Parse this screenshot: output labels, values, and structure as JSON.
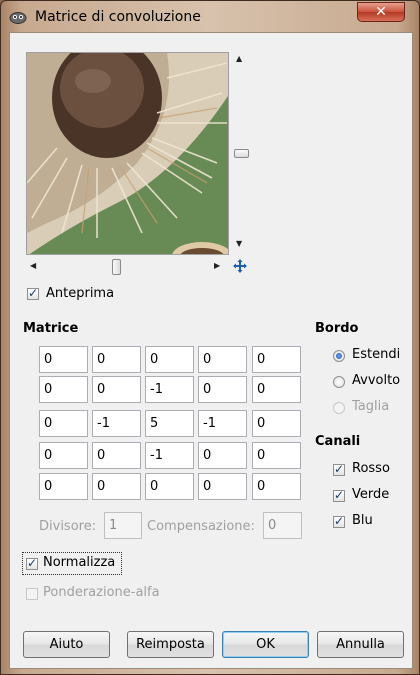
{
  "window": {
    "title": "Matrice di convoluzione",
    "close_label": "✕"
  },
  "preview": {
    "checkbox_label": "Anteprima",
    "checked": true
  },
  "matrix": {
    "title": "Matrice",
    "rows": [
      [
        "0",
        "0",
        "0",
        "0",
        "0"
      ],
      [
        "0",
        "0",
        "-1",
        "0",
        "0"
      ],
      [
        "0",
        "-1",
        "5",
        "-1",
        "0"
      ],
      [
        "0",
        "0",
        "-1",
        "0",
        "0"
      ],
      [
        "0",
        "0",
        "0",
        "0",
        "0"
      ]
    ],
    "divisor_label": "Divisore:",
    "divisor_value": "1",
    "offset_label": "Compensazione:",
    "offset_value": "0"
  },
  "border": {
    "title": "Bordo",
    "options": [
      {
        "label": "Estendi",
        "selected": true,
        "disabled": false
      },
      {
        "label": "Avvolto",
        "selected": false,
        "disabled": false
      },
      {
        "label": "Taglia",
        "selected": false,
        "disabled": true
      }
    ]
  },
  "channels": {
    "title": "Canali",
    "items": [
      {
        "label": "Rosso",
        "checked": true
      },
      {
        "label": "Verde",
        "checked": true
      },
      {
        "label": "Blu",
        "checked": true
      }
    ]
  },
  "options": {
    "normalize_label": "Normalizza",
    "normalize_checked": true,
    "alpha_label": "Ponderazione-alfa",
    "alpha_checked": false
  },
  "buttons": {
    "help": "Aiuto",
    "reset": "Reimposta",
    "ok": "OK",
    "cancel": "Annulla"
  },
  "colors": {
    "accent": "#3c7fb1",
    "preview_background": "#6d8f55"
  }
}
